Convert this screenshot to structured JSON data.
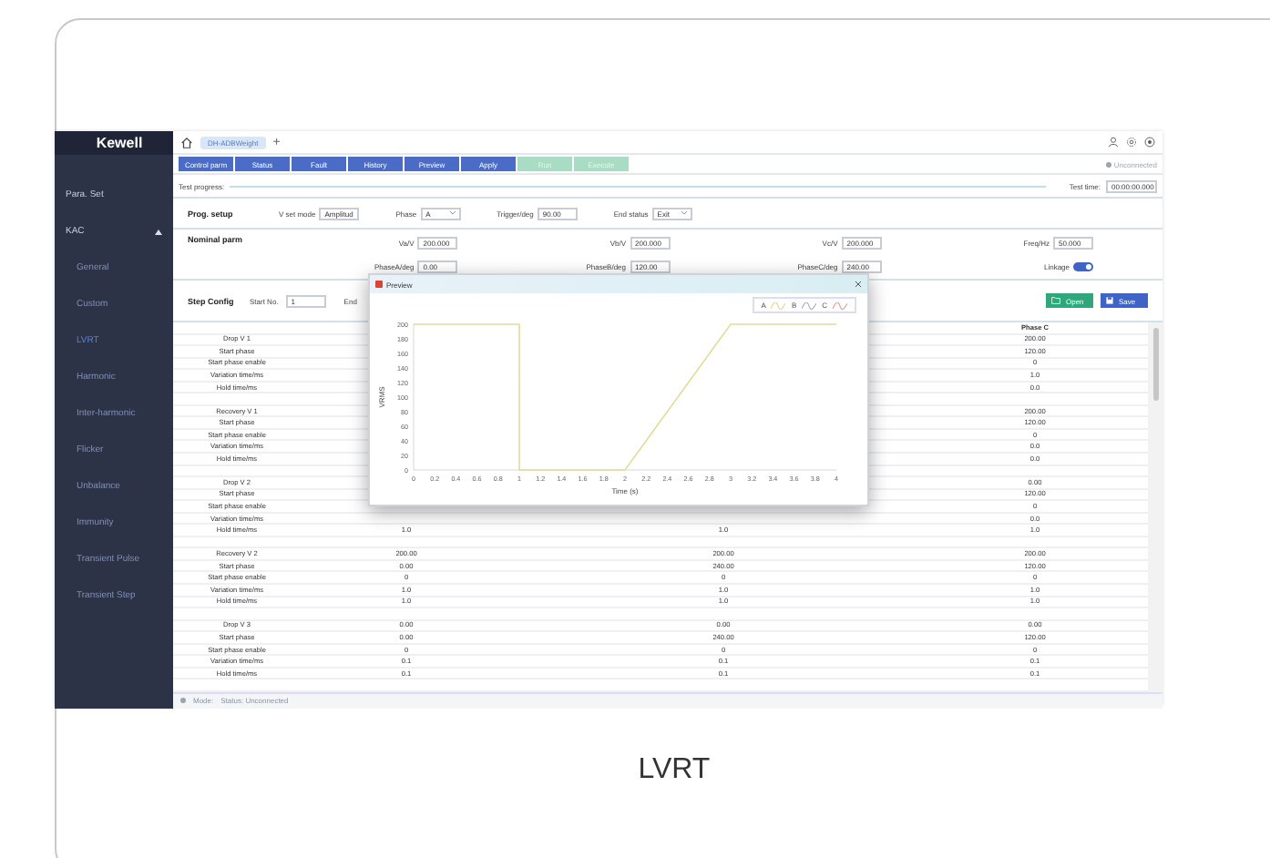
{
  "app": {
    "logo": "Kewell",
    "tab": "DH-ADBWeight",
    "new_tab": "+"
  },
  "toolbar": {
    "buttons": [
      {
        "label": "Control parm",
        "enabled": true
      },
      {
        "label": "Status",
        "enabled": true
      },
      {
        "label": "Fault",
        "enabled": true
      },
      {
        "label": "History",
        "enabled": true
      },
      {
        "label": "Preview",
        "enabled": true
      },
      {
        "label": "Apply",
        "enabled": true
      },
      {
        "label": "Run",
        "enabled": false
      },
      {
        "label": "Execute",
        "enabled": false
      }
    ],
    "connection": "Unconnected"
  },
  "sidebar": {
    "items": [
      {
        "label": "Para. Set",
        "selected": false
      },
      {
        "label": "KAC",
        "selected": false,
        "expanded": true,
        "children": [
          {
            "label": "General",
            "selected": false
          },
          {
            "label": "Custom",
            "selected": false
          },
          {
            "label": "LVRT",
            "selected": true
          },
          {
            "label": "Harmonic",
            "selected": false
          },
          {
            "label": "Inter-harmonic",
            "selected": false
          },
          {
            "label": "Flicker",
            "selected": false
          },
          {
            "label": "Unbalance",
            "selected": false
          },
          {
            "label": "Immunity",
            "selected": false
          },
          {
            "label": "Transient Pulse",
            "selected": false
          },
          {
            "label": "Transient Step",
            "selected": false
          }
        ]
      }
    ]
  },
  "progress": {
    "label": "Test progress:",
    "level": 0,
    "time_label": "Test time:",
    "time": "00:00:00.000"
  },
  "prog_setup": {
    "title": "Prog. setup",
    "fields": [
      {
        "label": "V set mode",
        "value": "Amplitud",
        "kind": "select"
      },
      {
        "label": "Phase",
        "value": "A",
        "kind": "select"
      },
      {
        "label": "Trigger/deg",
        "value": "90.00",
        "kind": "input"
      },
      {
        "label": "End status",
        "value": "Exit",
        "kind": "select"
      }
    ]
  },
  "nominal": {
    "title": "Nominal parm",
    "fields": [
      {
        "label": "Va/V",
        "value": "200.000"
      },
      {
        "label": "Vb/V",
        "value": "200.000"
      },
      {
        "label": "Vc/V",
        "value": "200.000"
      },
      {
        "label": "Freq/Hz",
        "value": "50.000"
      }
    ],
    "phase_fields": [
      {
        "label": "PhaseA/deg",
        "value": "0.00"
      },
      {
        "label": "PhaseB/deg",
        "value": "120.00"
      },
      {
        "label": "PhaseC/deg",
        "value": "240.00"
      }
    ],
    "linkage": {
      "label": "Linkage",
      "on": true
    }
  },
  "step_config": {
    "title": "Step Config",
    "start_label": "Start No.",
    "start_value": "1",
    "end_label": "End",
    "open": "Open",
    "save": "Save"
  },
  "table": {
    "header_c": "Phase C",
    "rows": [
      {
        "kind": "row",
        "label": "Drop V 1",
        "c": "200.00"
      },
      {
        "kind": "row",
        "label": "Start phase",
        "c": "120.00"
      },
      {
        "kind": "row",
        "label": "Start phase enable",
        "c": "0"
      },
      {
        "kind": "row",
        "label": "Variation time/ms",
        "c": "1.0"
      },
      {
        "kind": "row",
        "label": "Hold time/ms",
        "c": "0.0"
      },
      {
        "kind": "gap"
      },
      {
        "kind": "row",
        "label": "Recovery V 1",
        "c": "200.00"
      },
      {
        "kind": "row",
        "label": "Start phase",
        "c": "120.00"
      },
      {
        "kind": "row",
        "label": "Start phase enable",
        "c": "0"
      },
      {
        "kind": "row",
        "label": "Variation time/ms",
        "c": "0.0"
      },
      {
        "kind": "row",
        "label": "Hold time/ms",
        "c": "0.0"
      },
      {
        "kind": "gap"
      },
      {
        "kind": "row",
        "label": "Drop V 2",
        "c": "0.00"
      },
      {
        "kind": "row",
        "label": "Start phase",
        "c": "120.00"
      },
      {
        "kind": "row",
        "label": "Start phase enable",
        "c": "0"
      },
      {
        "kind": "row",
        "label": "Variation time/ms",
        "c": "0.0"
      },
      {
        "kind": "row",
        "label": "Hold time/ms",
        "a": "1.0",
        "b": "1.0",
        "c": "1.0"
      },
      {
        "kind": "gap"
      },
      {
        "kind": "row",
        "label": "Recovery V 2",
        "a": "200.00",
        "b": "200.00",
        "c": "200.00"
      },
      {
        "kind": "row",
        "label": "Start phase",
        "a": "0.00",
        "b": "240.00",
        "c": "120.00"
      },
      {
        "kind": "row",
        "label": "Start phase enable",
        "a": "0",
        "b": "0",
        "c": "0"
      },
      {
        "kind": "row",
        "label": "Variation time/ms",
        "a": "1.0",
        "b": "1.0",
        "c": "1.0"
      },
      {
        "kind": "row",
        "label": "Hold time/ms",
        "a": "1.0",
        "b": "1.0",
        "c": "1.0"
      },
      {
        "kind": "gap"
      },
      {
        "kind": "row",
        "label": "Drop V 3",
        "a": "0.00",
        "b": "0.00",
        "c": "0.00"
      },
      {
        "kind": "row",
        "label": "Start phase",
        "a": "0.00",
        "b": "240.00",
        "c": "120.00"
      },
      {
        "kind": "row",
        "label": "Start phase enable",
        "a": "0",
        "b": "0",
        "c": "0"
      },
      {
        "kind": "row",
        "label": "Variation time/ms",
        "a": "0.1",
        "b": "0.1",
        "c": "0.1"
      },
      {
        "kind": "row",
        "label": "Hold time/ms",
        "a": "0.1",
        "b": "0.1",
        "c": "0.1"
      },
      {
        "kind": "gap"
      }
    ]
  },
  "preview": {
    "title": "Preview",
    "legend": [
      {
        "label": "A",
        "color": "#e2dc9a"
      },
      {
        "label": "B",
        "color": "#aeb3bd"
      },
      {
        "label": "C",
        "color": "#e6a0a0"
      }
    ],
    "chart_data": {
      "type": "line",
      "xlabel": "Time (s)",
      "ylabel": "VRMS",
      "x": [
        0,
        1,
        1,
        2,
        3,
        4
      ],
      "series": [
        {
          "color": "#e2dc9a",
          "values": [
            200,
            200,
            0,
            0,
            200,
            200
          ]
        }
      ],
      "xlim": [
        0,
        4
      ],
      "ylim": [
        0,
        200
      ],
      "xticks": [
        0,
        {
          "value": 0.2,
          "label": "0.2"
        },
        {
          "value": 0.4,
          "label": "0.4"
        },
        {
          "value": 0.6,
          "label": "0.6"
        },
        {
          "value": 0.8,
          "label": "0.8"
        },
        1,
        {
          "value": 1.2,
          "label": "1.2"
        },
        {
          "value": 1.4,
          "label": "1.4"
        },
        {
          "value": 1.6,
          "label": "1.6"
        },
        {
          "value": 1.8,
          "label": "1.8"
        },
        2,
        {
          "value": 2.2,
          "label": "2.2"
        },
        {
          "value": 2.4,
          "label": "2.4"
        },
        {
          "value": 2.6,
          "label": "2.6"
        },
        {
          "value": 2.8,
          "label": "2.8"
        },
        3,
        {
          "value": 3.2,
          "label": "3.2"
        },
        {
          "value": 3.4,
          "label": "3.4"
        },
        {
          "value": 3.6,
          "label": "3.6"
        },
        {
          "value": 3.8,
          "label": "3.8"
        },
        4
      ],
      "yticks": [
        0,
        20,
        40,
        60,
        80,
        100,
        120,
        140,
        160,
        180,
        200
      ]
    }
  },
  "status_bar": {
    "mode": "Mode:",
    "status": "Status: Unconnected"
  },
  "caption": "LVRT"
}
